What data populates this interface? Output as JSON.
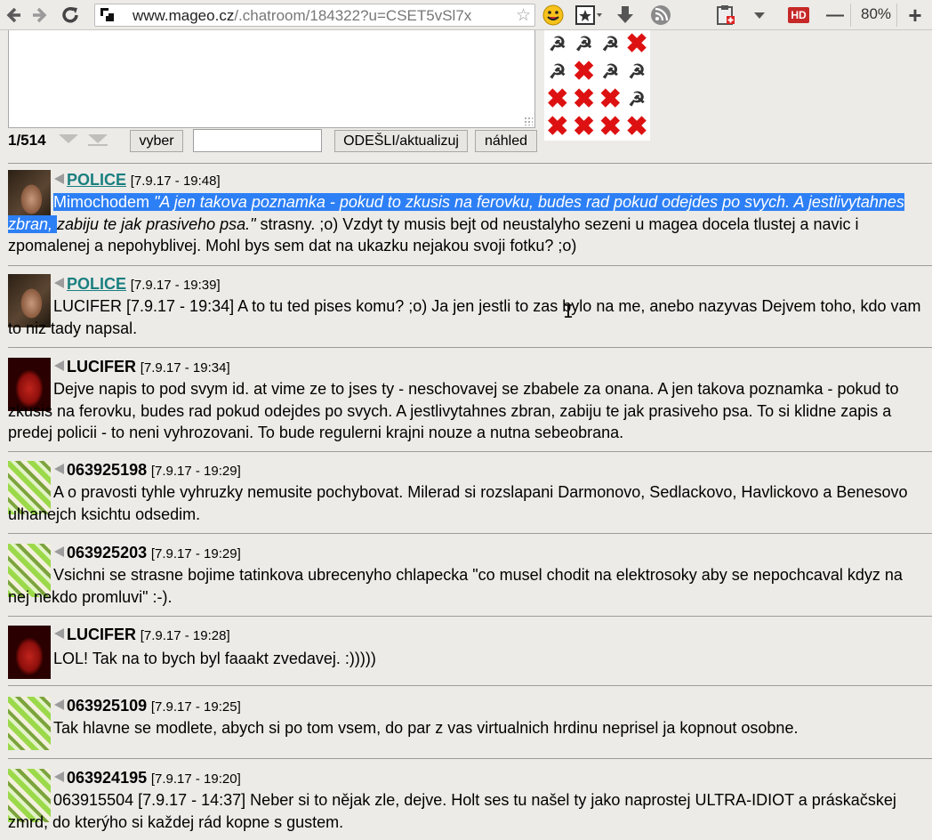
{
  "browser": {
    "url_host": "www.mageo.cz",
    "url_rest": "/.chatroom/184322?u=CSET5vSl7x",
    "zoom": "80%",
    "zoom_minus": "—",
    "zoom_plus": "+",
    "hd_badge": "HD"
  },
  "compose": {
    "counter": "1/514",
    "choose_button": "vyber",
    "send_button": "ODEŠLI/aktualizuj",
    "preview_button": "náhled",
    "search_value": ""
  },
  "messages": [
    {
      "author": "POLICE",
      "time": "[7.9.17 - 19:48]",
      "lead_selected": "Mimochodem ",
      "quote_selected": "\"A jen takova poznamka - pokud to zkusis na ferovku, budes rad pokud odejdes po svych. A jestlivytahnes zbran, ",
      "quote_rest": "zabiju te jak prasiveho psa.\"",
      "text": " strasny. ;o) Vzdyt ty musis bejt od neustalyho sezeni u magea docela tlustej a navic i zpomalenej a nepohyblivej. Mohl bys sem dat na ukazku nejakou svoji fotku? ;o)"
    },
    {
      "author": "POLICE",
      "time": "[7.9.17 - 19:39]",
      "text": "LUCIFER [7.9.17 - 19:34] A to tu ted pises komu? ;o) Ja jen jestli to zas bylo na me, anebo nazyvas Dejvem toho, kdo vam to niz tady napsal."
    },
    {
      "author": "LUCIFER",
      "time": "[7.9.17 - 19:34]",
      "text": "Dejve napis to pod svym id. at vime ze to jses ty - neschovavej se zbabele za onana. A jen takova poznamka - pokud to zkusis na ferovku, budes rad pokud odejdes po svych. A jestlivytahnes zbran, zabiju te jak prasiveho psa. To si klidne zapis a predej policii - to neni vyhrozovani. To bude regulerni krajni nouze a nutna sebeobrana."
    },
    {
      "author": "063925198",
      "time": "[7.9.17 - 19:29]",
      "text": "A o pravosti tyhle vyhruzky nemusite pochybovat. Milerad si rozslapani Darmonovo, Sedlackovo, Havlickovo a Benesovo ulhanejch ksichtu odsedim."
    },
    {
      "author": "063925203",
      "time": "[7.9.17 - 19:29]",
      "text": "Vsichni se strasne bojime tatinkova ubrecenyho chlapecka \"co musel chodit na elektrosoky aby se nepochcaval kdyz na nej nekdo promluvi\" :-)."
    },
    {
      "author": "LUCIFER",
      "time": "[7.9.17 - 19:28]",
      "text": "LOL! Tak na to bych byl faaakt zvedavej. :)))))"
    },
    {
      "author": "063925109",
      "time": "[7.9.17 - 19:25]",
      "text": "Tak hlavne se modlete, abych si po tom vsem, do par z vas virtualnich hrdinu neprisel ja kopnout osobne."
    },
    {
      "author": "063924195",
      "time": "[7.9.17 - 19:20]",
      "text": "063915504 [7.9.17 - 14:37] Neber si to nějak zle, dejve. Holt ses tu našel ty jako naprostej ULTRA-IDIOT a práskačskej zmrd, do kterýho si každej rád kopne s gustem."
    }
  ]
}
